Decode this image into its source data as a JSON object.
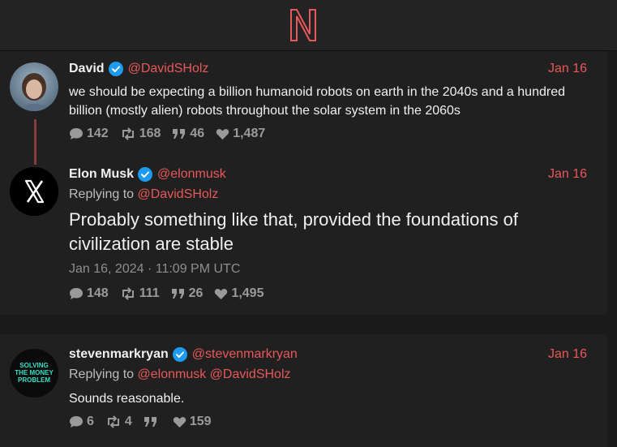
{
  "colors": {
    "accent": "#e8585a",
    "background": "#1a1a1a",
    "card": "#202020",
    "verified": "#1d9bf0"
  },
  "logo": {
    "letter": "N"
  },
  "tweets": [
    {
      "name": "David",
      "handle": "@DavidSHolz",
      "date": "Jan 16",
      "text": "we should be expecting a billion humanoid robots on earth in the 2040s and a hundred billion (mostly alien) robots throughout the solar system in the 2060s",
      "stats": {
        "replies": "142",
        "retweets": "168",
        "quotes": "46",
        "likes": "1,487"
      }
    },
    {
      "name": "Elon Musk",
      "handle": "@elonmusk",
      "date": "Jan 16",
      "replying_prefix": "Replying to",
      "replying_to": "@DavidSHolz",
      "text": "Probably something like that, provided the foundations of civilization are stable",
      "timestamp": "Jan 16, 2024 · 11:09 PM UTC",
      "stats": {
        "replies": "148",
        "retweets": "111",
        "quotes": "26",
        "likes": "1,495"
      }
    },
    {
      "name": "stevenmarkryan",
      "handle": "@stevenmarkryan",
      "date": "Jan 16",
      "replying_prefix": "Replying to",
      "replying_to_1": "@elonmusk",
      "replying_to_2": "@DavidSHolz",
      "avatar_text": [
        "SOLVING",
        "THE MONEY",
        "PROBLEM"
      ],
      "text": "Sounds reasonable.",
      "stats": {
        "replies": "6",
        "retweets": "4",
        "quotes": "",
        "likes": "159"
      }
    }
  ]
}
